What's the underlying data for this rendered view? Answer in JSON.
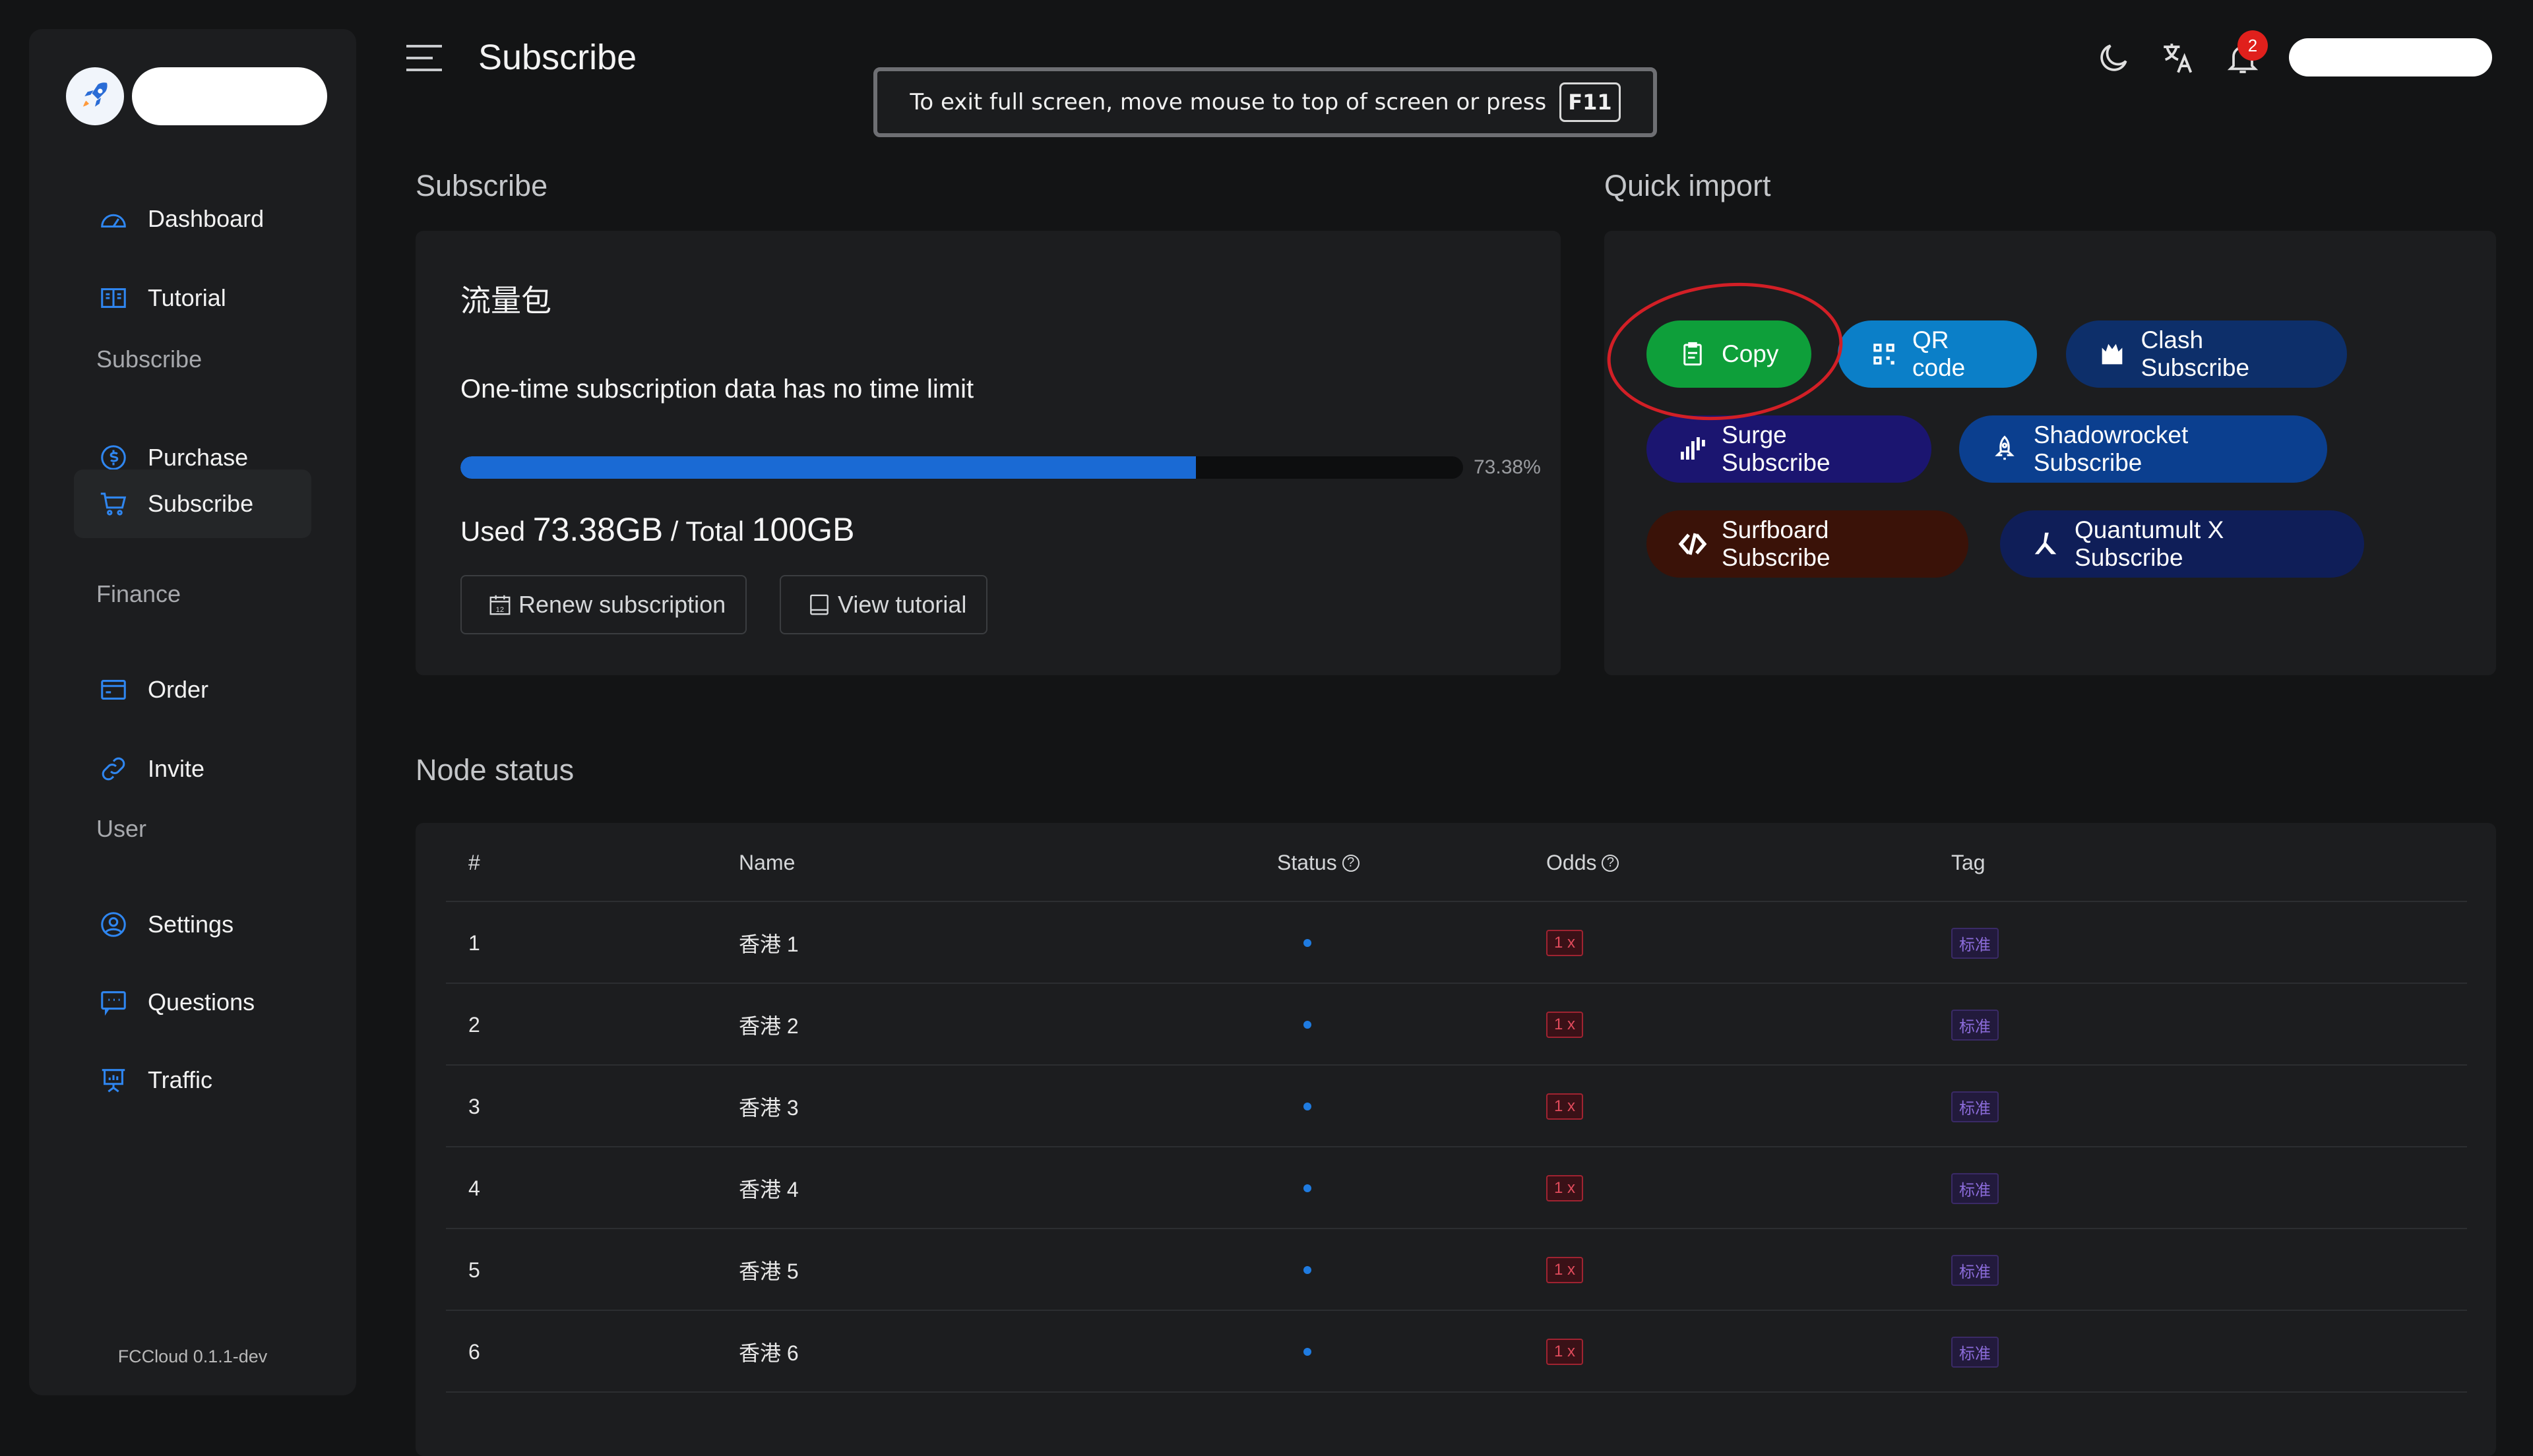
{
  "app": {
    "title": "Subscribe",
    "version": "FCCloud 0.1.1-dev"
  },
  "fullscreen_notice": {
    "text": "To exit full screen, move mouse to top of screen or press",
    "key": "F11"
  },
  "header": {
    "notification_count": "2",
    "icons": [
      "menu-icon",
      "moon-icon",
      "translate-icon",
      "bell-icon"
    ]
  },
  "sidebar": {
    "items": [
      {
        "label": "Dashboard",
        "icon": "dashboard-icon"
      },
      {
        "label": "Tutorial",
        "icon": "book-icon"
      },
      {
        "label": "Purchase",
        "icon": "dollar-icon"
      },
      {
        "label": "Subscribe",
        "icon": "cart-icon",
        "active": true
      },
      {
        "label": "Order",
        "icon": "card-icon"
      },
      {
        "label": "Invite",
        "icon": "link-icon"
      },
      {
        "label": "Settings",
        "icon": "user-circle-icon"
      },
      {
        "label": "Questions",
        "icon": "chat-icon"
      },
      {
        "label": "Traffic",
        "icon": "presentation-icon"
      }
    ],
    "sections": [
      "Subscribe",
      "Finance",
      "User"
    ]
  },
  "subscribe": {
    "section_title": "Subscribe",
    "plan_name": "流量包",
    "description": "One-time subscription data has no time limit",
    "progress_percent": 73.38,
    "progress_label": "73.38%",
    "used_prefix": "Used",
    "used_value": "73.38GB",
    "total_prefix": "/ Total",
    "total_value": "100GB",
    "renew_label": "Renew subscription",
    "tutorial_label": "View tutorial"
  },
  "quick_import": {
    "section_title": "Quick import",
    "buttons": [
      {
        "label": "Copy",
        "color": "#0e9f3a",
        "icon": "clipboard-icon"
      },
      {
        "label": "QR code",
        "color": "#0b7fc8",
        "icon": "qrcode-icon"
      },
      {
        "label": "Clash Subscribe",
        "color": "#0d2f6a",
        "icon": "clash-icon"
      },
      {
        "label": "Surge Subscribe",
        "color": "#1b1570",
        "icon": "surge-icon"
      },
      {
        "label": "Shadowrocket Subscribe",
        "color": "#0b3f8f",
        "icon": "rocket-icon"
      },
      {
        "label": "Surfboard Subscribe",
        "color": "#3a1208",
        "icon": "surfboard-icon"
      },
      {
        "label": "Quantumult X Subscribe",
        "color": "#0f1e58",
        "icon": "quantumult-icon"
      }
    ]
  },
  "node_status": {
    "section_title": "Node status",
    "columns": [
      "#",
      "Name",
      "Status",
      "Odds",
      "Tag"
    ],
    "rows": [
      {
        "num": "1",
        "name": "香港 1",
        "odds": "1 x",
        "tag": "标准"
      },
      {
        "num": "2",
        "name": "香港 2",
        "odds": "1 x",
        "tag": "标准"
      },
      {
        "num": "3",
        "name": "香港 3",
        "odds": "1 x",
        "tag": "标准"
      },
      {
        "num": "4",
        "name": "香港 4",
        "odds": "1 x",
        "tag": "标准"
      },
      {
        "num": "5",
        "name": "香港 5",
        "odds": "1 x",
        "tag": "标准"
      },
      {
        "num": "6",
        "name": "香港 6",
        "odds": "1 x",
        "tag": "标准"
      }
    ]
  },
  "colors": {
    "accent_blue": "#1a6ad4",
    "annotation_red": "#d21f26",
    "background": "#131415",
    "card": "#1c1d1f"
  }
}
